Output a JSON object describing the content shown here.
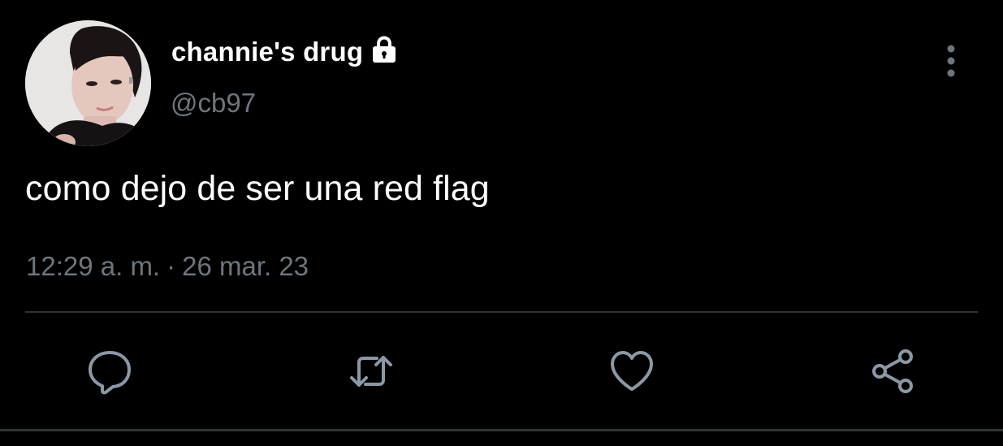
{
  "user": {
    "display_name": "channie's drug",
    "handle": "@cb97",
    "avatar_icon": "user-avatar",
    "protected_icon": "lock-icon"
  },
  "tweet": {
    "text": "como dejo de ser una red flag",
    "time": "12:29 a. m.",
    "separator": "·",
    "date": "26 mar. 23"
  },
  "actions": {
    "reply_icon": "reply-icon",
    "retweet_icon": "retweet-icon",
    "like_icon": "heart-icon",
    "share_icon": "share-icon"
  },
  "menu": {
    "more_icon": "more-vertical-icon"
  },
  "colors": {
    "background": "#000000",
    "primary_text": "#ffffff",
    "secondary_text": "#6e767d",
    "divider": "#2f3336",
    "icon": "#8b98a5"
  }
}
